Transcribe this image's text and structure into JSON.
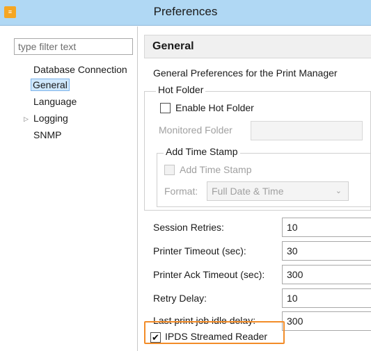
{
  "window": {
    "title": "Preferences",
    "app_icon": "settings-sliders-icon"
  },
  "sidebar": {
    "filter_placeholder": "type filter text",
    "items": [
      {
        "label": "Database Connection",
        "selected": false,
        "expandable": false
      },
      {
        "label": "General",
        "selected": true,
        "expandable": false
      },
      {
        "label": "Language",
        "selected": false,
        "expandable": false
      },
      {
        "label": "Logging",
        "selected": false,
        "expandable": true
      },
      {
        "label": "SNMP",
        "selected": false,
        "expandable": false
      }
    ]
  },
  "main": {
    "section_title": "General",
    "description": "General Preferences for the Print Manager",
    "hot_folder": {
      "group_label": "Hot Folder",
      "enable_label": "Enable Hot Folder",
      "enable_checked": false,
      "monitored_folder_label": "Monitored Folder",
      "monitored_folder_value": "",
      "timestamp_group_label": "Add Time Stamp",
      "add_time_stamp_label": "Add Time Stamp",
      "add_time_stamp_checked": false,
      "format_label": "Format:",
      "format_value": "Full Date & Time"
    },
    "settings": [
      {
        "label": "Session Retries:",
        "value": "10"
      },
      {
        "label": "Printer Timeout (sec):",
        "value": "30"
      },
      {
        "label": "Printer Ack Timeout (sec):",
        "value": "300"
      },
      {
        "label": "Retry Delay:",
        "value": "10"
      },
      {
        "label": "Last print job idle delay:",
        "value": "300"
      }
    ],
    "ipds": {
      "label": "IPDS Streamed Reader",
      "checked": true
    }
  },
  "colors": {
    "titlebar": "#b0d8f4",
    "highlight": "#f28c28",
    "selection": "#cfe8fc"
  }
}
